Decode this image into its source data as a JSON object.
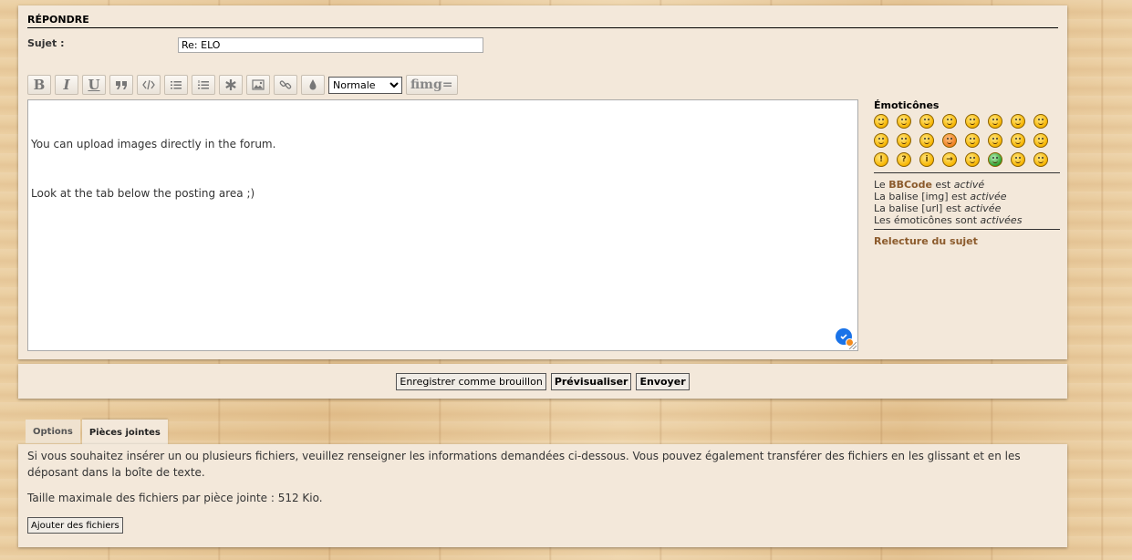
{
  "reply_form": {
    "title": "RÉPONDRE",
    "subject_label": "Sujet :",
    "subject_value": "Re: ELO",
    "toolbar": {
      "bold": "B",
      "italic": "I",
      "underline": "U",
      "font_size_selected": "Normale",
      "font_size_options": [
        "Normale"
      ],
      "flash_img": "fimg="
    },
    "message_lines": [
      "You can upload images directly in the forum.",
      "Look at the tab below the posting area ;)"
    ]
  },
  "sidebar": {
    "emoticons_title": "Émoticônes",
    "bbcode_prefix": "Le ",
    "bbcode_link": "BBCode",
    "bbcode_mid": " est ",
    "bbcode_state": "activé",
    "img_prefix": "La balise [img] est ",
    "img_state": "activée",
    "url_prefix": "La balise [url] est ",
    "url_state": "activée",
    "smilies_prefix": "Les émoticônes sont ",
    "smilies_state": "activées",
    "review_link": "Relecture du sujet"
  },
  "actions": {
    "save_draft": "Enregistrer comme brouillon",
    "preview": "Prévisualiser",
    "submit": "Envoyer"
  },
  "tabs": [
    {
      "label": "Options"
    },
    {
      "label": "Pièces jointes"
    }
  ],
  "attachments": {
    "description": "Si vous souhaitez insérer un ou plusieurs fichiers, veuillez renseigner les informations demandées ci-dessous. Vous pouvez également transférer des fichiers en les glissant et en les déposant dans la boîte de texte.",
    "max_size": "Taille maximale des fichiers par pièce jointe : 512 Kio.",
    "add_button": "Ajouter des fichiers"
  }
}
